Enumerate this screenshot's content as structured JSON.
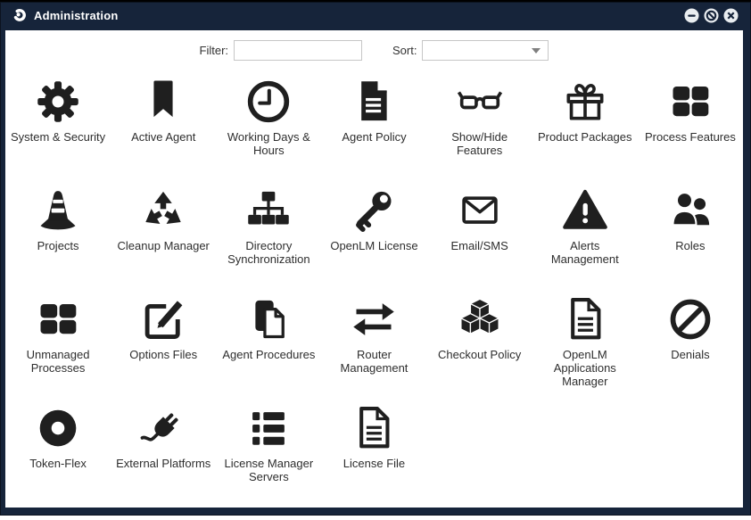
{
  "colors": {
    "titlebar": "#16243A",
    "frame": "#16243A",
    "icon": "#1F1F1F",
    "label": "#2E2E2E",
    "control_background": "#E9EDF0",
    "input_border": "#C6C6C6"
  },
  "window": {
    "title": "Administration",
    "logo": "openlm-logo-icon",
    "controls": [
      {
        "id": "minimize",
        "icon": "minimize-icon"
      },
      {
        "id": "maximize-disabled",
        "icon": "slashed-circle-icon"
      },
      {
        "id": "close",
        "icon": "close-icon"
      }
    ]
  },
  "toolbar": {
    "filter": {
      "label": "Filter:",
      "value": "",
      "placeholder": ""
    },
    "sort": {
      "label": "Sort:",
      "value": "",
      "placeholder": ""
    }
  },
  "grid": {
    "items": [
      {
        "label": "System & Security",
        "icon": "gear-icon"
      },
      {
        "label": "Active Agent",
        "icon": "bookmark-icon"
      },
      {
        "label": "Working Days & Hours",
        "icon": "clock-icon"
      },
      {
        "label": "Agent Policy",
        "icon": "document-solid-icon"
      },
      {
        "label": "Show/Hide Features",
        "icon": "glasses-icon"
      },
      {
        "label": "Product Packages",
        "icon": "gift-icon"
      },
      {
        "label": "Process Features",
        "icon": "grid-squares-icon"
      },
      {
        "label": "Projects",
        "icon": "traffic-cone-icon"
      },
      {
        "label": "Cleanup Manager",
        "icon": "recycle-icon"
      },
      {
        "label": "Directory Synchronization",
        "icon": "sitemap-icon"
      },
      {
        "label": "OpenLM License",
        "icon": "key-icon"
      },
      {
        "label": "Email/SMS",
        "icon": "envelope-icon"
      },
      {
        "label": "Alerts Management",
        "icon": "warning-triangle-icon"
      },
      {
        "label": "Roles",
        "icon": "users-icon"
      },
      {
        "label": "Unmanaged Processes",
        "icon": "grid-squares-icon"
      },
      {
        "label": "Options Files",
        "icon": "edit-square-icon"
      },
      {
        "label": "Agent Procedures",
        "icon": "copy-documents-icon"
      },
      {
        "label": "Router Management",
        "icon": "exchange-arrows-icon"
      },
      {
        "label": "Checkout Policy",
        "icon": "cubes-icon"
      },
      {
        "label": "OpenLM Applications Manager",
        "icon": "document-outline-icon"
      },
      {
        "label": "Denials",
        "icon": "ban-icon"
      },
      {
        "label": "Token-Flex",
        "icon": "donut-icon"
      },
      {
        "label": "External Platforms",
        "icon": "plug-icon"
      },
      {
        "label": "License Manager Servers",
        "icon": "server-list-icon"
      },
      {
        "label": "License File",
        "icon": "document-outline-icon"
      }
    ]
  }
}
